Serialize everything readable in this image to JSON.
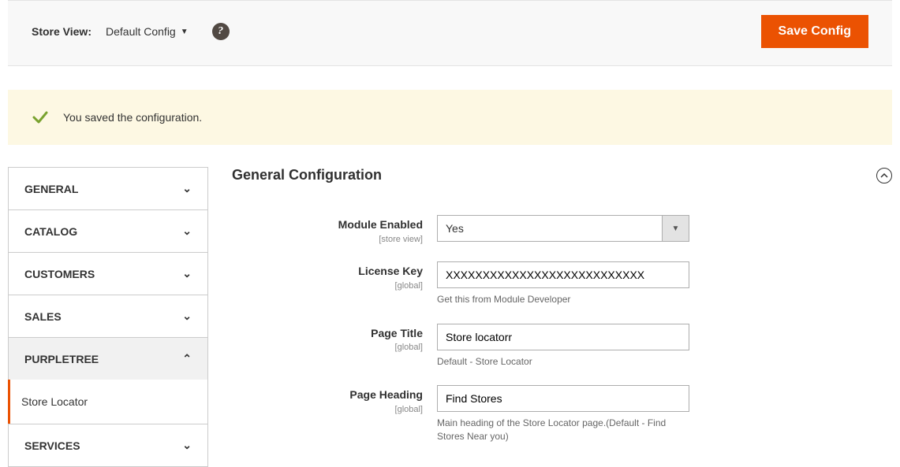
{
  "topbar": {
    "store_view_label": "Store View:",
    "store_view_value": "Default Config",
    "save_button": "Save Config"
  },
  "message": {
    "text": "You saved the configuration."
  },
  "sidebar": {
    "tabs": [
      {
        "label": "GENERAL",
        "expanded": false
      },
      {
        "label": "CATALOG",
        "expanded": false
      },
      {
        "label": "CUSTOMERS",
        "expanded": false
      },
      {
        "label": "SALES",
        "expanded": false
      },
      {
        "label": "PURPLETREE",
        "expanded": true
      },
      {
        "label": "SERVICES",
        "expanded": false
      }
    ],
    "active_subitem": "Store Locator"
  },
  "section": {
    "title": "General Configuration"
  },
  "fields": {
    "module_enabled": {
      "label": "Module Enabled",
      "scope": "[store view]",
      "value": "Yes"
    },
    "license_key": {
      "label": "License Key",
      "scope": "[global]",
      "value": "XXXXXXXXXXXXXXXXXXXXXXXXXXX",
      "note": "Get this from Module Developer"
    },
    "page_title": {
      "label": "Page Title",
      "scope": "[global]",
      "value": "Store locatorr",
      "note": "Default - Store Locator"
    },
    "page_heading": {
      "label": "Page Heading",
      "scope": "[global]",
      "value": "Find Stores",
      "note": "Main heading of the Store Locator page.(Default - Find Stores Near you)"
    }
  }
}
